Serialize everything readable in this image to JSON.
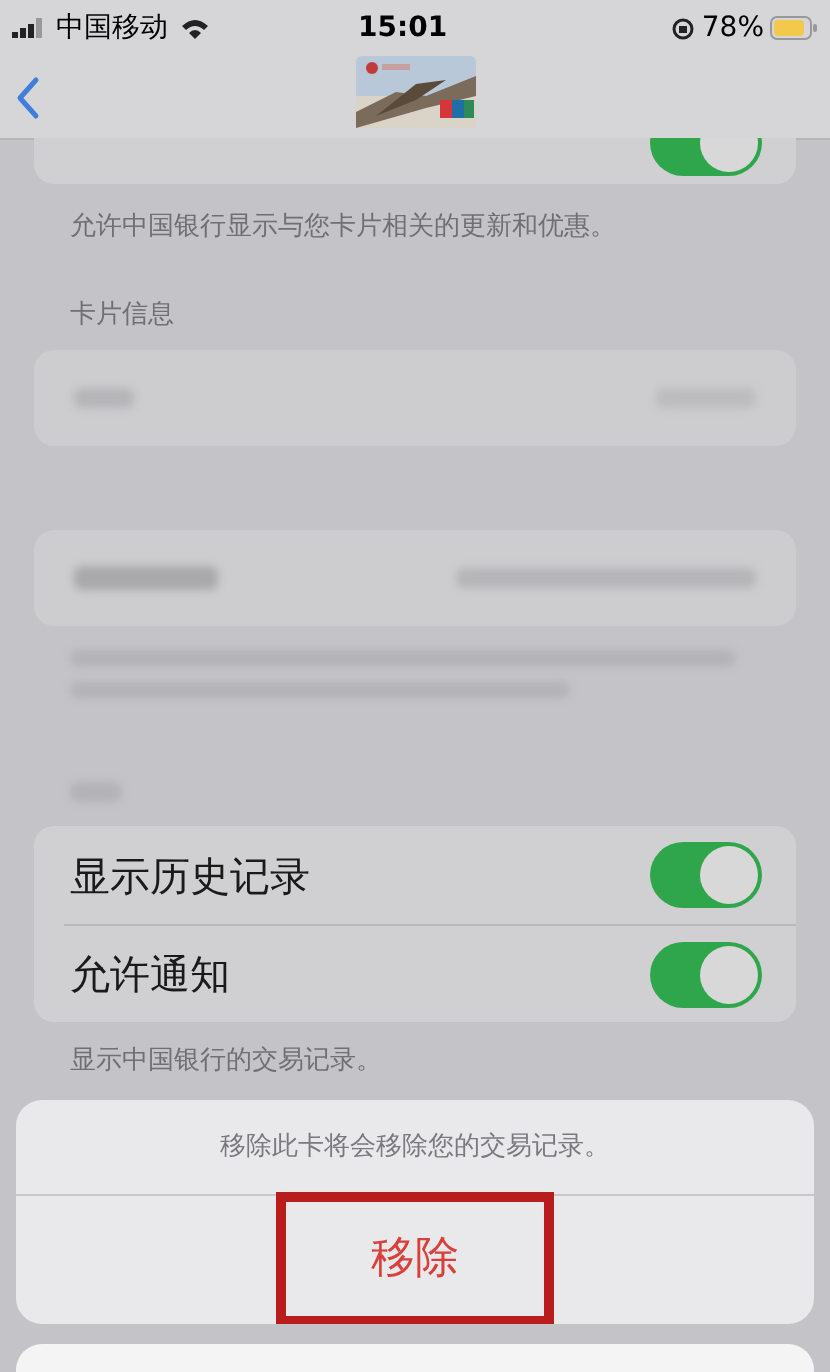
{
  "status_bar": {
    "carrier": "中国移动",
    "time": "15:01",
    "battery": "78%"
  },
  "updates_toggle": {
    "on": true
  },
  "updates_footer": "允许中国银行显示与您卡片相关的更新和优惠。",
  "card_info_header": "卡片信息",
  "toggles": [
    {
      "label": "显示历史记录",
      "on": true
    },
    {
      "label": "允许通知",
      "on": true
    }
  ],
  "toggles_footer": "显示中国银行的交易记录。",
  "action_sheet": {
    "message": "移除此卡将会移除您的交易记录。",
    "button": "移除"
  }
}
